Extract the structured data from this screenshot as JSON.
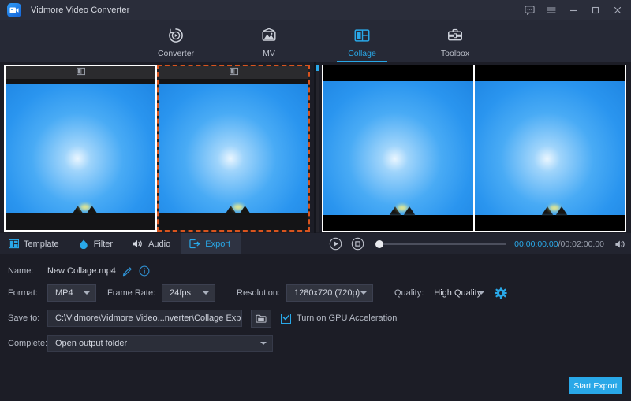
{
  "window": {
    "title": "Vidmore Video Converter",
    "logo_icon": "video-camera-icon",
    "controls": [
      {
        "name": "feedback-icon",
        "label": "Feedback"
      },
      {
        "name": "menu-icon",
        "label": "Menu"
      },
      {
        "name": "minimize-icon",
        "label": "Minimize"
      },
      {
        "name": "maximize-icon",
        "label": "Maximize"
      },
      {
        "name": "close-icon",
        "label": "Close"
      }
    ]
  },
  "topnav": {
    "active": "Collage",
    "items": [
      {
        "label": "Converter",
        "icon": "converter-icon",
        "active": false
      },
      {
        "label": "MV",
        "icon": "mv-icon",
        "active": false
      },
      {
        "label": "Collage",
        "icon": "collage-icon",
        "active": true
      },
      {
        "label": "Toolbox",
        "icon": "toolbox-icon",
        "active": false
      }
    ]
  },
  "editor": {
    "cells": [
      {
        "name": "collage-cell-1",
        "selected": false,
        "header_icon": "split-layout-icon"
      },
      {
        "name": "collage-cell-2",
        "selected": true,
        "header_icon": "split-layout-icon"
      }
    ]
  },
  "preview": {
    "panes": 2
  },
  "tooltabs": [
    {
      "label": "Template",
      "icon": "template-icon",
      "active": false
    },
    {
      "label": "Filter",
      "icon": "filter-icon",
      "active": false
    },
    {
      "label": "Audio",
      "icon": "audio-icon",
      "active": false
    },
    {
      "label": "Export",
      "icon": "export-icon",
      "active": true
    }
  ],
  "player": {
    "play_icon": "play-icon",
    "stop_icon": "stop-icon",
    "volume_icon": "volume-icon",
    "current_time": "00:00:00.00",
    "separator": "/",
    "total_time": "00:02:00.00",
    "progress_percent": 0
  },
  "export": {
    "name_label": "Name:",
    "name_value": "New Collage.mp4",
    "edit_icon": "pencil-icon",
    "info_icon": "info-icon",
    "format_label": "Format:",
    "format_value": "MP4",
    "framerate_label": "Frame Rate:",
    "framerate_value": "24fps",
    "resolution_label": "Resolution:",
    "resolution_value": "1280x720 (720p)",
    "quality_label": "Quality:",
    "quality_value": "High Quality",
    "settings_icon": "gear-icon",
    "saveto_label": "Save to:",
    "saveto_value": "C:\\Vidmore\\Vidmore Video...nverter\\Collage Exported",
    "browse_dots": "•••",
    "folder_icon": "folder-icon",
    "gpu_label": "Turn on GPU Acceleration",
    "gpu_checked": true,
    "check_icon": "check-icon",
    "complete_label": "Complete:",
    "complete_value": "Open output folder",
    "start_button": "Start Export"
  },
  "colors": {
    "accent": "#29a8e8",
    "titlebar": "#2a2d3a",
    "nav_bg": "#262936",
    "body_bg": "#1c1d26",
    "selection_border": "#d9541e",
    "text": "#c9ccd6"
  }
}
